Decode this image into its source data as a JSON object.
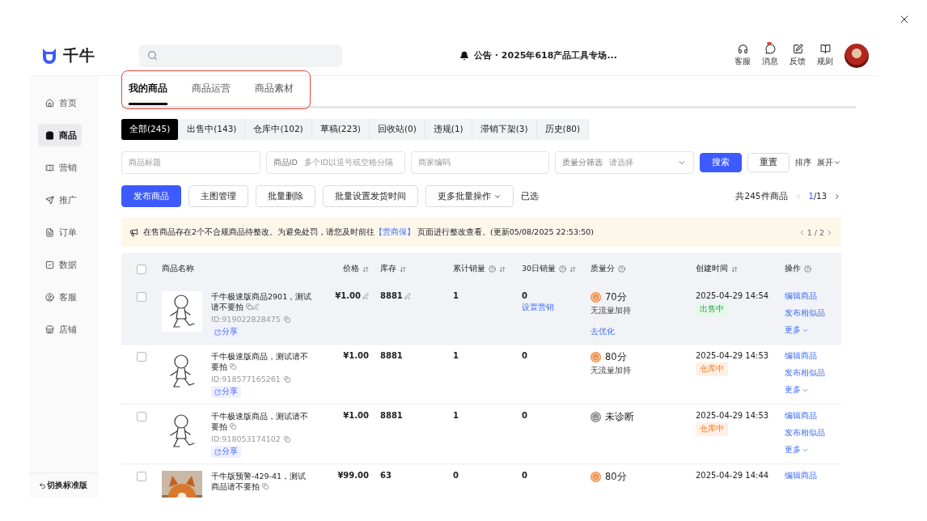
{
  "header": {
    "brand": "千牛",
    "announcement": "公告 · 2025年618产品工具专场...",
    "tools": [
      {
        "kind": "headset",
        "label": "客服",
        "badge": false
      },
      {
        "kind": "message",
        "label": "消息",
        "badge": true
      },
      {
        "kind": "feedback",
        "label": "反馈",
        "badge": false
      },
      {
        "kind": "rules",
        "label": "规则",
        "badge": false
      }
    ]
  },
  "sidebar": {
    "items": [
      {
        "kind": "home",
        "label": "首页",
        "selected": false
      },
      {
        "kind": "goods",
        "label": "商品",
        "selected": true
      },
      {
        "kind": "marketing",
        "label": "营销",
        "selected": false
      },
      {
        "kind": "promote",
        "label": "推广",
        "selected": false
      },
      {
        "kind": "orders",
        "label": "订单",
        "selected": false
      },
      {
        "kind": "data",
        "label": "数据",
        "selected": false
      },
      {
        "kind": "service",
        "label": "客服",
        "selected": false
      },
      {
        "kind": "store",
        "label": "店铺",
        "selected": false
      }
    ],
    "switch_label": "切换标准版"
  },
  "tabs": [
    {
      "label": "我的商品",
      "selected": true
    },
    {
      "label": "商品运营",
      "selected": false
    },
    {
      "label": "商品素材",
      "selected": false
    }
  ],
  "status_tabs": [
    {
      "label": "全部(245)",
      "selected": true
    },
    {
      "label": "出售中(143)",
      "selected": false
    },
    {
      "label": "仓库中(102)",
      "selected": false
    },
    {
      "label": "草稿(223)",
      "selected": false
    },
    {
      "label": "回收站(0)",
      "selected": false
    },
    {
      "label": "违规(1)",
      "selected": false
    },
    {
      "label": "滞销下架(3)",
      "selected": false
    },
    {
      "label": "历史(80)",
      "selected": false
    }
  ],
  "filters": {
    "fields": [
      {
        "kind": "input",
        "placeholder": "商品标题"
      },
      {
        "kind": "input",
        "label": "商品ID",
        "placeholder": "多个ID以逗号或空格分隔"
      },
      {
        "kind": "input",
        "placeholder": "商家编码"
      },
      {
        "kind": "select",
        "label": "质量分筛选",
        "placeholder": "请选择"
      }
    ],
    "search": "搜索",
    "reset": "重置",
    "sort": "排序",
    "expand": "展开"
  },
  "actions": {
    "buttons": [
      {
        "label": "发布商品",
        "primary": true,
        "dropdown": false
      },
      {
        "label": "主图管理",
        "primary": false,
        "dropdown": false
      },
      {
        "label": "批量删除",
        "primary": false,
        "dropdown": false
      },
      {
        "label": "批量设置发货时间",
        "primary": false,
        "dropdown": false
      },
      {
        "label": "更多批量操作",
        "primary": false,
        "dropdown": true
      }
    ],
    "selected_label": "已选",
    "total": "共245件商品",
    "page_current": "1",
    "page_total": "/13"
  },
  "notice": {
    "before": "在售商品存在2个不合规商品待整改。为避免处罚，请您及时前往",
    "link": "【营商保】",
    "after": " 页面进行整改查看。(更新05/08/2025 22:53:50)",
    "pager": "1 / 2"
  },
  "table": {
    "select_all_checked": false,
    "columns": [
      {
        "label": "商品名称",
        "help": false,
        "sortable": false
      },
      {
        "label": "价格",
        "help": false,
        "sortable": true
      },
      {
        "label": "库存",
        "help": false,
        "sortable": true
      },
      {
        "label": "累计销量",
        "help": true,
        "sortable": true
      },
      {
        "label": "30日销量",
        "help": true,
        "sortable": true
      },
      {
        "label": "质量分",
        "help": true,
        "sortable": false
      },
      {
        "label": "创建时间",
        "help": false,
        "sortable": true
      },
      {
        "label": "操作",
        "help": true,
        "sortable": false
      }
    ],
    "rows": [
      {
        "kind": "sketch",
        "checked": false,
        "highlighted": true,
        "title": "千牛极速版商品2901，测试请不要拍",
        "title_editable": true,
        "id": "ID:919022828475",
        "share": "分享",
        "price": "¥1.00",
        "price_editable": true,
        "stock": "8881",
        "stock_editable": true,
        "sold_total": "1",
        "sold_30d": "0",
        "marketing": "设置营销",
        "score": {
          "diagnosed": true,
          "text": "70分",
          "note": "无流量加持",
          "optimize": "去优化"
        },
        "created": "2025-04-29 14:54",
        "status": {
          "kind": "selling",
          "text": "出售中"
        },
        "actions": [
          "编辑商品",
          "发布相似品"
        ],
        "more": "更多"
      },
      {
        "kind": "sketch",
        "checked": false,
        "highlighted": false,
        "title": "千牛极速版商品，测试请不要拍",
        "title_editable": false,
        "id": "ID:918577165261",
        "share": "分享",
        "price": "¥1.00",
        "price_editable": false,
        "stock": "8881",
        "stock_editable": false,
        "sold_total": "1",
        "sold_30d": "0",
        "score": {
          "diagnosed": true,
          "text": "80分",
          "note": "无流量加持"
        },
        "created": "2025-04-29 14:53",
        "status": {
          "kind": "warehouse",
          "text": "仓库中"
        },
        "actions": [
          "编辑商品",
          "发布相似品"
        ],
        "more": "更多"
      },
      {
        "kind": "sketch",
        "checked": false,
        "highlighted": false,
        "title": "千牛极速版商品，测试请不要拍",
        "title_editable": false,
        "id": "ID:918053174102",
        "share": "分享",
        "price": "¥1.00",
        "price_editable": false,
        "stock": "8881",
        "stock_editable": false,
        "sold_total": "1",
        "sold_30d": "0",
        "score": {
          "diagnosed": false,
          "text": "未诊断"
        },
        "created": "2025-04-29 14:53",
        "status": {
          "kind": "warehouse",
          "text": "仓库中"
        },
        "actions": [
          "编辑商品",
          "发布相似品"
        ],
        "more": "更多"
      },
      {
        "kind": "picture",
        "checked": false,
        "highlighted": false,
        "title": "千牛版预警-429-41，测试商品请不要拍",
        "title_editable": false,
        "price": "¥99.00",
        "price_editable": false,
        "stock": "63",
        "stock_editable": false,
        "sold_total": "0",
        "sold_30d": "0",
        "score": {
          "diagnosed": true,
          "text": "80分"
        },
        "created": "2025-04-29 14:44",
        "actions": [
          "编辑商品"
        ]
      }
    ]
  }
}
